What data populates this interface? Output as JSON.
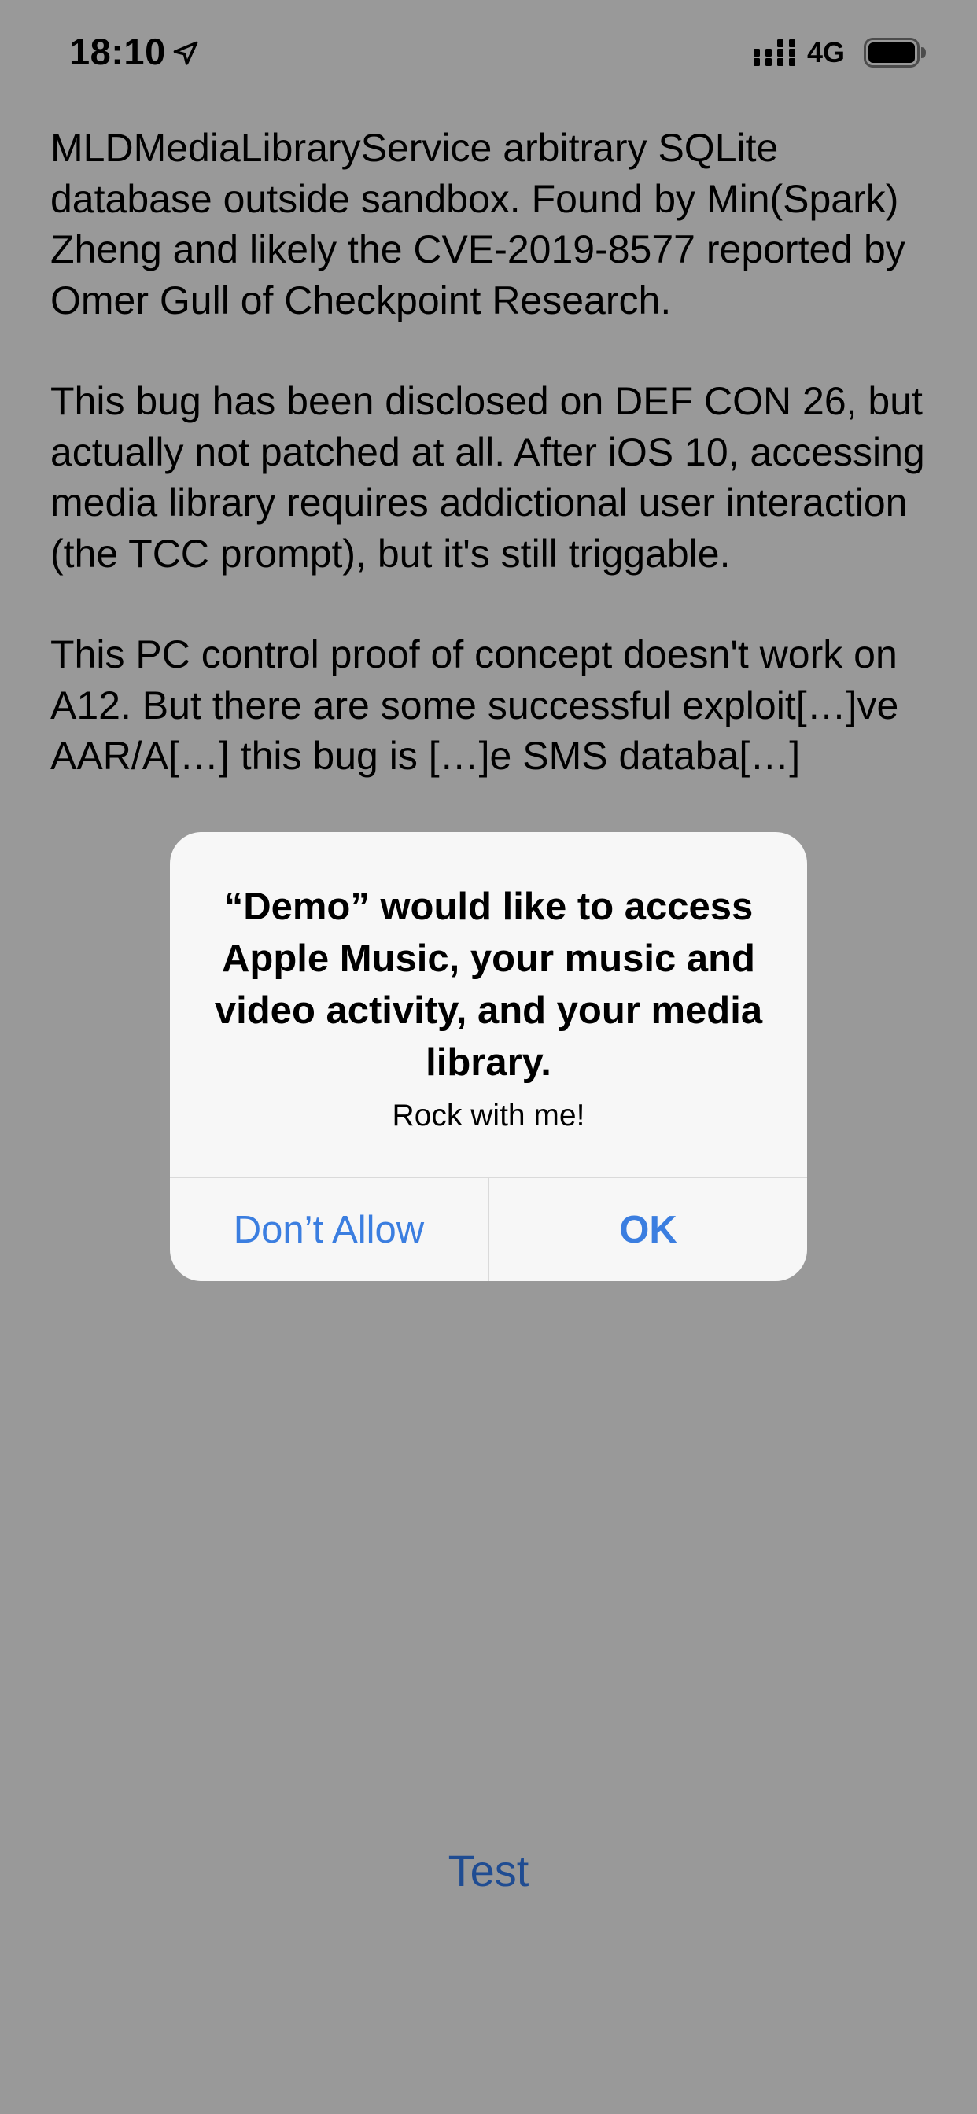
{
  "status_bar": {
    "time": "18:10",
    "network": "4G",
    "icons": [
      "location-arrow-icon",
      "cellular-signal-icon",
      "battery-icon"
    ]
  },
  "description": {
    "paragraphs": [
      "MLDMediaLibraryService arbitrary SQLite database outside sandbox. Found by Min(Spark) Zheng and likely the CVE-2019-8577 reported by Omer Gull of Checkpoint Research.",
      "This bug has been disclosed on DEF CON 26, but actually not patched at all. After iOS 10, accessing media library requires addictional user interaction (the TCC prompt), but it's still triggable.",
      "This PC control proof of concept doesn't work on A12. But there are some successful exploit[…]ve AAR/A[…] this bug is […]e SMS databa[…]"
    ]
  },
  "alert": {
    "title": "“Demo” would like to access Apple Music, your music and video activity, and your media library.",
    "message": "Rock with me!",
    "cancel_label": "Don’t Allow",
    "ok_label": "OK"
  },
  "test_button": {
    "label": "Test"
  },
  "colors": {
    "background_dim": "#999999",
    "alert_background": "#f7f7f7",
    "alert_button": "#3b7ee0",
    "test_button": "#1f4c92"
  }
}
